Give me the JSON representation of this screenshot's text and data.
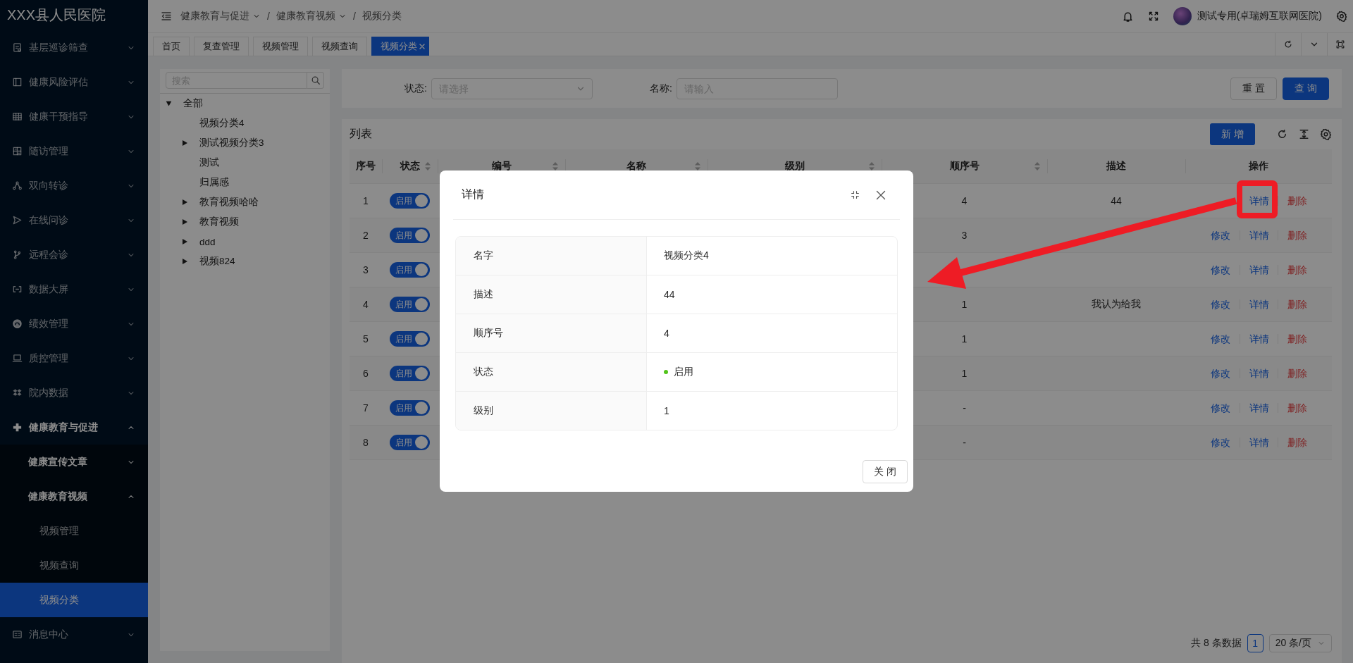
{
  "sidebar": {
    "title": "XXX县人民医院",
    "items": [
      {
        "label": "基层巡诊筛查",
        "expanded": false
      },
      {
        "label": "健康风险评估",
        "expanded": false
      },
      {
        "label": "健康干预指导",
        "expanded": false
      },
      {
        "label": "随访管理",
        "expanded": false
      },
      {
        "label": "双向转诊",
        "expanded": false
      },
      {
        "label": "在线问诊",
        "expanded": false
      },
      {
        "label": "远程会诊",
        "expanded": false
      },
      {
        "label": "数据大屏",
        "expanded": false
      },
      {
        "label": "绩效管理",
        "expanded": false
      },
      {
        "label": "质控管理",
        "expanded": false
      },
      {
        "label": "院内数据",
        "expanded": false
      },
      {
        "label": "健康教育与促进",
        "expanded": true,
        "children": [
          {
            "label": "健康宣传文章",
            "expanded": false
          },
          {
            "label": "健康教育视频",
            "expanded": true,
            "children": [
              {
                "label": "视频管理",
                "selected": false
              },
              {
                "label": "视频查询",
                "selected": false
              },
              {
                "label": "视频分类",
                "selected": true
              }
            ]
          }
        ]
      },
      {
        "label": "消息中心",
        "expanded": false
      }
    ]
  },
  "header": {
    "breadcrumb": [
      {
        "label": "健康教育与促进",
        "dropdown": true
      },
      {
        "separator": "/",
        "label": "健康教育视频",
        "dropdown": true
      },
      {
        "separator": "/",
        "label": "视频分类",
        "dropdown": false
      }
    ],
    "user": "测试专用(卓瑞姆互联网医院)"
  },
  "tabs": [
    {
      "label": "首页",
      "selected": false,
      "closable": false
    },
    {
      "label": "复查管理",
      "selected": false,
      "closable": false
    },
    {
      "label": "视频管理",
      "selected": false,
      "closable": false
    },
    {
      "label": "视频查询",
      "selected": false,
      "closable": false
    },
    {
      "label": "视频分类",
      "selected": true,
      "closable": true
    }
  ],
  "tree": {
    "search_placeholder": "搜索",
    "nodes": [
      {
        "label": "全部",
        "expanded": true,
        "children": [
          {
            "label": "视频分类4"
          },
          {
            "label": "测试视频分类3",
            "expanded": false
          },
          {
            "label": "测试"
          },
          {
            "label": "归属感"
          },
          {
            "label": "教育视频哈哈",
            "expanded": false
          },
          {
            "label": "教育视频",
            "expanded": false
          },
          {
            "label": "ddd",
            "expanded": false
          },
          {
            "label": "视频824",
            "expanded": false
          }
        ]
      }
    ]
  },
  "filters": [
    {
      "label": "状态:",
      "kind": "select",
      "placeholder": "请选择"
    },
    {
      "label": "名称:",
      "kind": "input",
      "placeholder": "请输入"
    }
  ],
  "filter_buttons": [
    {
      "label": "重置",
      "kind": "default"
    },
    {
      "label": "查询",
      "kind": "primary"
    }
  ],
  "table": {
    "title": "列表",
    "add_button": "新增",
    "columns": [
      {
        "label": "序号",
        "sortable": false
      },
      {
        "label": "状态",
        "sortable": true
      },
      {
        "label": "编号",
        "sortable": true
      },
      {
        "label": "名称",
        "sortable": true
      },
      {
        "label": "级别",
        "sortable": true
      },
      {
        "label": "顺序号",
        "sortable": true
      },
      {
        "label": "描述",
        "sortable": false
      },
      {
        "label": "操作",
        "sortable": false
      }
    ],
    "rows": [
      {
        "index": "1",
        "status": {
          "label": "启用",
          "on": true
        },
        "order": "4",
        "description": "44",
        "actions": [
          {
            "label": "详情",
            "kind": "detail"
          },
          {
            "label": "删除",
            "kind": "delete"
          }
        ]
      },
      {
        "index": "2",
        "status": {
          "label": "启用",
          "on": true
        },
        "order": "3",
        "actions": [
          {
            "label": "修改",
            "kind": "edit"
          },
          {
            "label": "详情",
            "kind": "detail"
          },
          {
            "label": "删除",
            "kind": "delete"
          }
        ]
      },
      {
        "index": "3",
        "status": {
          "label": "启用",
          "on": true
        },
        "actions": [
          {
            "label": "修改",
            "kind": "edit"
          },
          {
            "label": "详情",
            "kind": "detail"
          },
          {
            "label": "删除",
            "kind": "delete"
          }
        ]
      },
      {
        "index": "4",
        "status": {
          "label": "启用",
          "on": true
        },
        "order": "1",
        "description": "我认为给我",
        "actions": [
          {
            "label": "修改",
            "kind": "edit"
          },
          {
            "label": "详情",
            "kind": "detail"
          },
          {
            "label": "删除",
            "kind": "delete"
          }
        ]
      },
      {
        "index": "5",
        "status": {
          "label": "启用",
          "on": true
        },
        "order": "1",
        "actions": [
          {
            "label": "修改",
            "kind": "edit"
          },
          {
            "label": "详情",
            "kind": "detail"
          },
          {
            "label": "删除",
            "kind": "delete"
          }
        ]
      },
      {
        "index": "6",
        "status": {
          "label": "启用",
          "on": true
        },
        "order": "1",
        "actions": [
          {
            "label": "修改",
            "kind": "edit"
          },
          {
            "label": "详情",
            "kind": "detail"
          },
          {
            "label": "删除",
            "kind": "delete"
          }
        ]
      },
      {
        "index": "7",
        "status": {
          "label": "启用",
          "on": true
        },
        "order": "-",
        "actions": [
          {
            "label": "修改",
            "kind": "edit"
          },
          {
            "label": "详情",
            "kind": "detail"
          },
          {
            "label": "删除",
            "kind": "delete"
          }
        ]
      },
      {
        "index": "8",
        "status": {
          "label": "启用",
          "on": true
        },
        "order": "-",
        "actions": [
          {
            "label": "修改",
            "kind": "edit"
          },
          {
            "label": "详情",
            "kind": "detail"
          },
          {
            "label": "删除",
            "kind": "delete"
          }
        ]
      }
    ]
  },
  "pagination": {
    "total": "共 8 条数据",
    "pages": [
      {
        "label": "1",
        "selected": true
      }
    ],
    "page_size": "20 条/页"
  },
  "modal": {
    "title": "详情",
    "fields": [
      {
        "label": "名字",
        "value": "视频分类4",
        "kind": "text"
      },
      {
        "label": "描述",
        "value": "44",
        "kind": "text"
      },
      {
        "label": "顺序号",
        "value": "4",
        "kind": "text"
      },
      {
        "label": "状态",
        "value": "启用",
        "kind": "status"
      },
      {
        "label": "级别",
        "value": "1",
        "kind": "text"
      }
    ],
    "close_button": "关闭"
  }
}
